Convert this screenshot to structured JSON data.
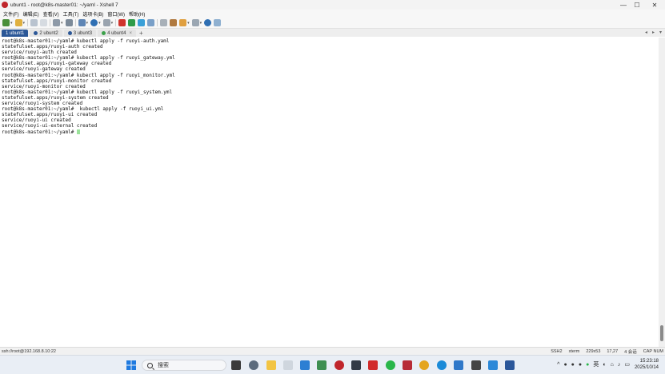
{
  "window": {
    "title": "ubunt1 - root@k8s-master01: ~/yaml - Xshell 7",
    "controls": {
      "minimize": "—",
      "maximize": "☐",
      "close": "✕"
    }
  },
  "menu": [
    "文件(F)",
    "编辑(E)",
    "查看(V)",
    "工具(T)",
    "选项卡(B)",
    "窗口(W)",
    "帮助(H)"
  ],
  "tabs": [
    {
      "label": "1 ubunt1",
      "active": true
    },
    {
      "label": "2 ubunt2",
      "active": false
    },
    {
      "label": "3 ubunt3",
      "active": false
    },
    {
      "label": "4 ubunt4",
      "active": false
    }
  ],
  "tab_add": "+",
  "terminal": {
    "lines": [
      "root@k8s-master01:~/yaml# kubectl apply -f ruoyi-auth.yaml",
      "statefulset.apps/ruoyi-auth created",
      "service/ruoyi-auth created",
      "root@k8s-master01:~/yaml# kubectl apply -f ruoyi_gateway.yml",
      "statefulset.apps/ruoyi-gateway created",
      "service/ruoyi-gateway created",
      "root@k8s-master01:~/yaml# kubectl apply -f ruoyi_monitor.yml",
      "statefulset.apps/ruoyi-monitor created",
      "service/ruoyi-monitor created",
      "root@k8s-master01:~/yaml# kubectl apply -f ruoyi_system.yml",
      "statefulset.apps/ruoyi-system created",
      "service/ruoyi-system created",
      "root@k8s-master01:~/yaml#  kubectl apply -f ruoyi_ui.yml",
      "statefulset.apps/ruoyi-ui created",
      "service/ruoyi-ui created",
      "service/ruoyi-ui-external created"
    ],
    "prompt": "root@k8s-master01:~/yaml# "
  },
  "status": {
    "connection": "ssh://root@192.168.8.10:22",
    "protocol": "SSH2",
    "term": "xterm",
    "size": "229x53",
    "position": "17,27",
    "sessions": "4 会话",
    "keys": "CAP NUM"
  },
  "taskbar": {
    "search_placeholder": "搜索",
    "ime": "英",
    "time": "15:23:18",
    "date": "2025/10/14"
  },
  "colors": {
    "accent": "#2b5797",
    "cursor": "#9be39b",
    "xshell_red": "#c0262c"
  }
}
